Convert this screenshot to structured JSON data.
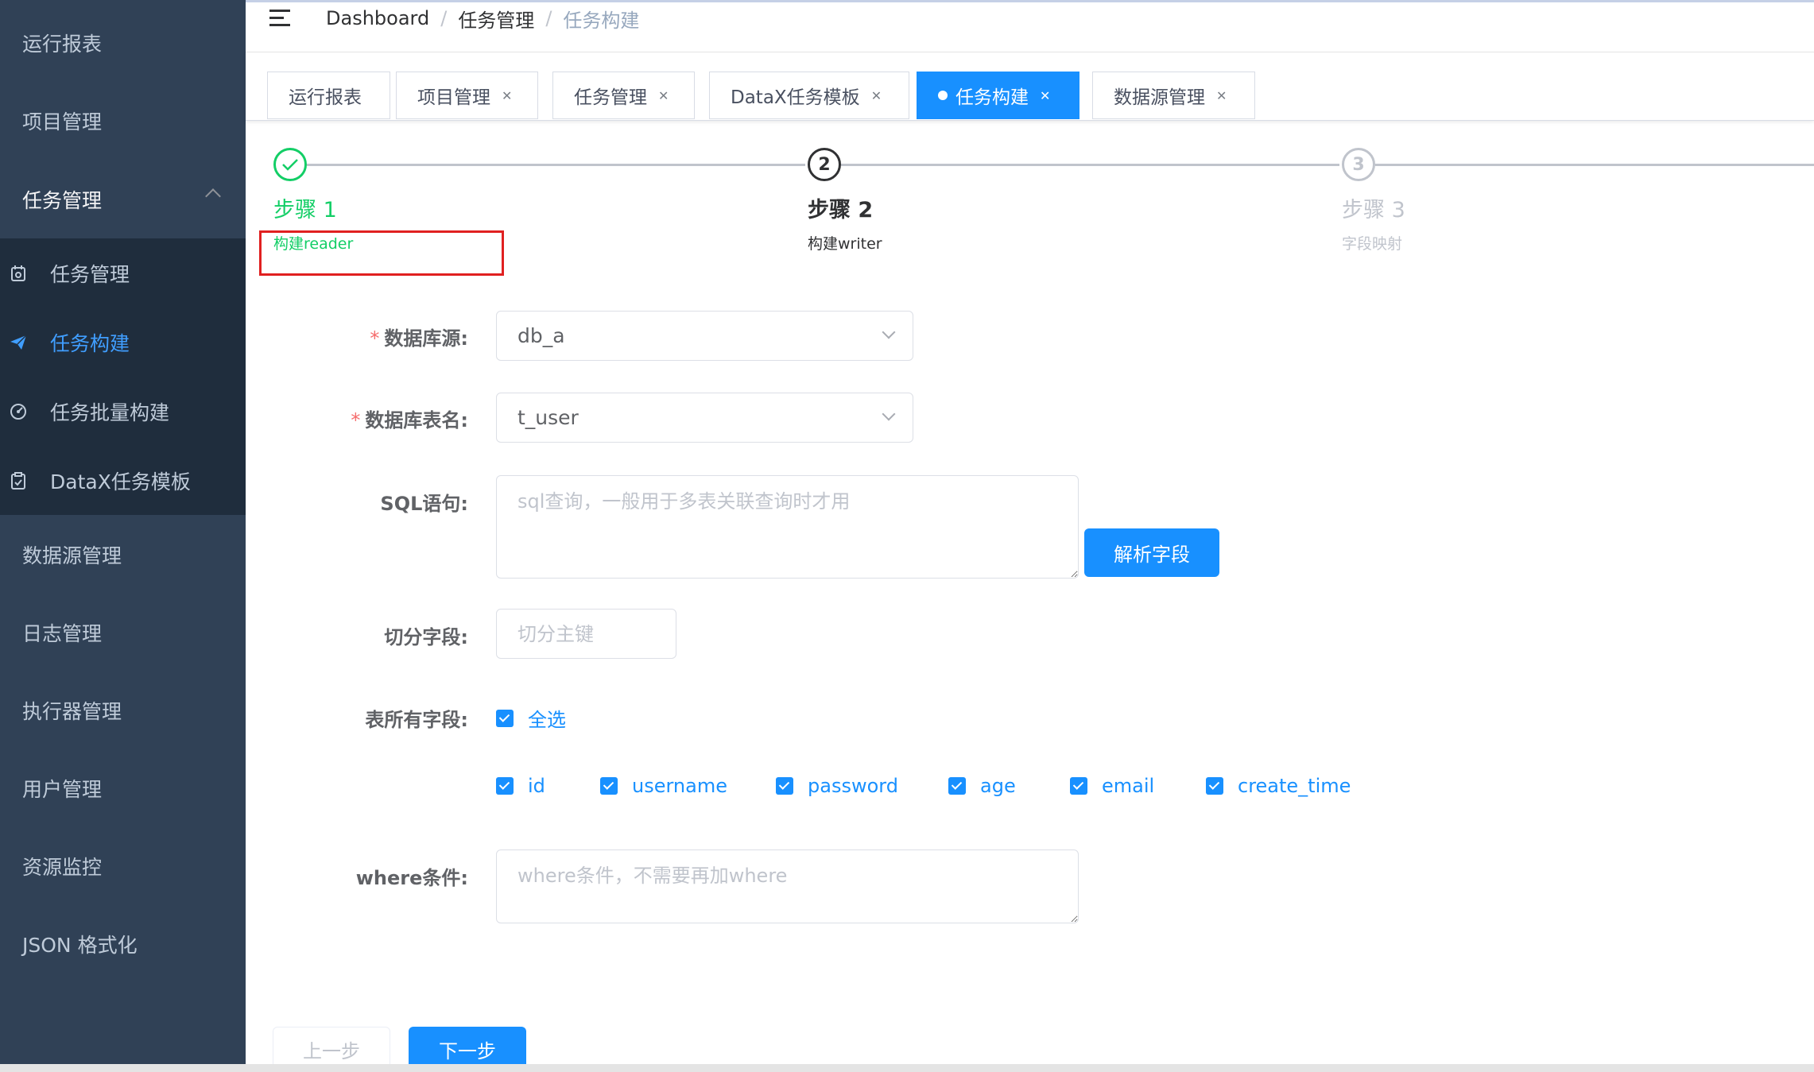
{
  "sidebar": {
    "top_items": [
      "运行报表",
      "项目管理",
      "任务管理"
    ],
    "sub_items": [
      {
        "label": "任务管理",
        "icon": "calendar-icon"
      },
      {
        "label": "任务构建",
        "icon": "paper-plane-icon"
      },
      {
        "label": "任务批量构建",
        "icon": "dashboard-icon"
      },
      {
        "label": "DataX任务模板",
        "icon": "clipboard-icon"
      }
    ],
    "bottom_items": [
      "数据源管理",
      "日志管理",
      "执行器管理",
      "用户管理",
      "资源监控",
      "JSON 格式化"
    ]
  },
  "breadcrumb": {
    "home": "Dashboard",
    "parent": "任务管理",
    "current": "任务构建",
    "sep": "/"
  },
  "tags": [
    {
      "label": "运行报表",
      "closable": false
    },
    {
      "label": "项目管理",
      "closable": true
    },
    {
      "label": "任务管理",
      "closable": true
    },
    {
      "label": "DataX任务模板",
      "closable": true
    },
    {
      "label": "任务构建",
      "closable": true,
      "active": true
    },
    {
      "label": "数据源管理",
      "closable": true
    }
  ],
  "steps": [
    {
      "title": "步骤 1",
      "desc": "构建reader",
      "status": "success"
    },
    {
      "title": "步骤 2",
      "desc": "构建writer",
      "number": "2",
      "status": "process"
    },
    {
      "title": "步骤 3",
      "desc": "字段映射",
      "number": "3",
      "status": "wait"
    }
  ],
  "form": {
    "datasource": {
      "label": "数据库源:",
      "value": "db_a",
      "required": "*"
    },
    "table": {
      "label": "数据库表名:",
      "value": "t_user",
      "required": "*"
    },
    "sql": {
      "label": "SQL语句:",
      "placeholder": "sql查询，一般用于多表关联查询时才用"
    },
    "parse_button": "解析字段",
    "split": {
      "label": "切分字段:",
      "placeholder": "切分主键"
    },
    "all_fields": {
      "label": "表所有字段:",
      "select_all": "全选"
    },
    "fields": [
      "id",
      "username",
      "password",
      "age",
      "email",
      "create_time"
    ],
    "where": {
      "label": "where条件:",
      "placeholder": "where条件，不需要再加where"
    }
  },
  "buttons": {
    "prev": "上一步",
    "next": "下一步"
  },
  "colors": {
    "sidebar": "#304156",
    "submenu": "#1f2d3d",
    "primary": "#1890ff",
    "success": "#13ce66",
    "highlight_box": "#e02020"
  }
}
